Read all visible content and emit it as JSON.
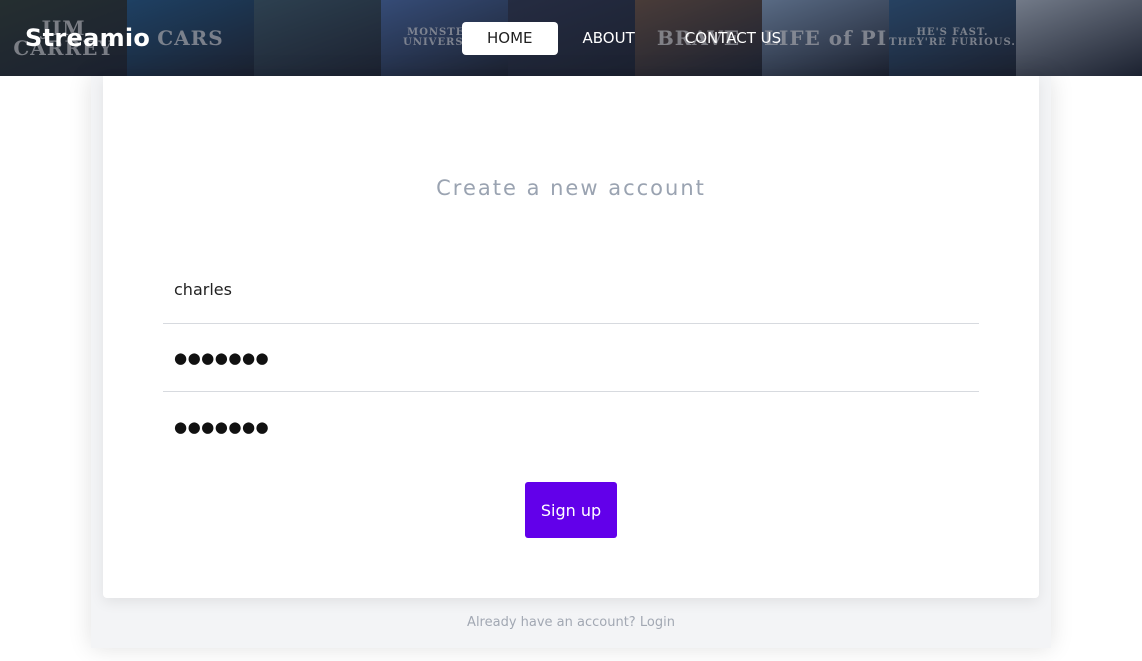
{
  "header": {
    "brand": "Streamio",
    "nav": [
      {
        "label": "HOME",
        "active": true
      },
      {
        "label": "ABOUT",
        "active": false
      },
      {
        "label": "CONTACT US",
        "active": false
      }
    ],
    "posters": [
      {
        "text": "JIM CARREY",
        "color": "#2c3a30"
      },
      {
        "text": "CARS",
        "color": "#1f5a8c"
      },
      {
        "text": "",
        "color": "#3b5a6a"
      },
      {
        "text": "MONSTERS UNIVERSITY",
        "color": "#4a6fb0"
      },
      {
        "text": "",
        "color": "#2c3550"
      },
      {
        "text": "BRAVE",
        "color": "#6e5240"
      },
      {
        "text": "LIFE of PI",
        "color": "#8aa6c8"
      },
      {
        "text": "HE'S FAST. THEY'RE FURIOUS.",
        "color": "#2f5d8a"
      },
      {
        "text": "",
        "color": "#b8c3d0"
      }
    ]
  },
  "form": {
    "title": "Create a new account",
    "username_value": "charles",
    "password_value": "●●●●●●●",
    "confirm_value": "●●●●●●●",
    "submit_label": "Sign up"
  },
  "footer": {
    "prompt": "Already have an account?",
    "login_label": "Login"
  }
}
